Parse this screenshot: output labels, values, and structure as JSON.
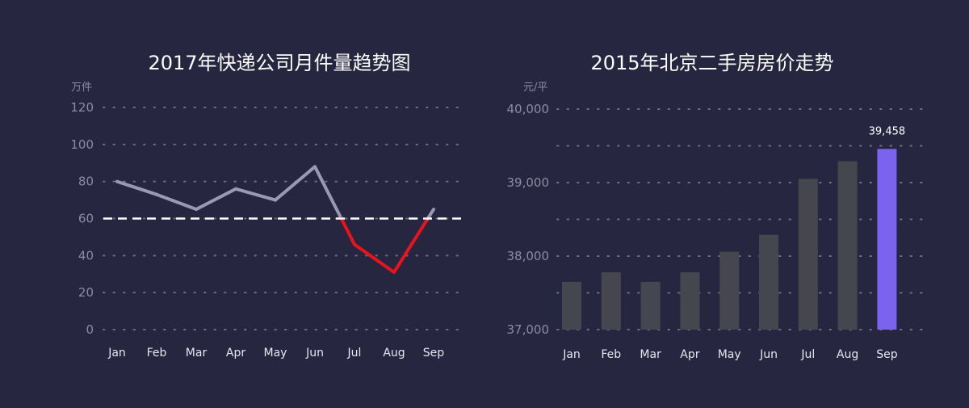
{
  "chart_data": [
    {
      "type": "line",
      "title": "2017年快递公司月件量趋势图",
      "ylabel": "万件",
      "categories": [
        "Jan",
        "Feb",
        "Mar",
        "Apr",
        "May",
        "Jun",
        "Jul",
        "Aug",
        "Sep"
      ],
      "series": [
        {
          "values": [
            80,
            73,
            65,
            76,
            70,
            88,
            46,
            31,
            65
          ]
        }
      ],
      "reference_line": 60,
      "ylim": [
        0,
        120
      ],
      "yticks": [
        "0",
        "20",
        "40",
        "60",
        "80",
        "100",
        "120"
      ],
      "grid": true,
      "colors": {
        "above": "#9a98b4",
        "below": "#e8141c",
        "reference": "#ffffff"
      }
    },
    {
      "type": "bar",
      "title": "2015年北京二手房房价走势",
      "ylabel": "元/平",
      "categories": [
        "Jan",
        "Feb",
        "Mar",
        "Apr",
        "May",
        "Jun",
        "Jul",
        "Aug",
        "Sep"
      ],
      "values": [
        37650,
        37780,
        37650,
        37780,
        38060,
        38290,
        39050,
        39290,
        39458
      ],
      "highlight": {
        "index": 8,
        "label": "39,458"
      },
      "ylim": [
        37000,
        40000
      ],
      "yticks": [
        "37,000",
        "38,000",
        "39,000",
        "40,000"
      ],
      "grid": true,
      "colors": {
        "bar": "#46464f",
        "highlight": "#7b63f0"
      }
    }
  ]
}
